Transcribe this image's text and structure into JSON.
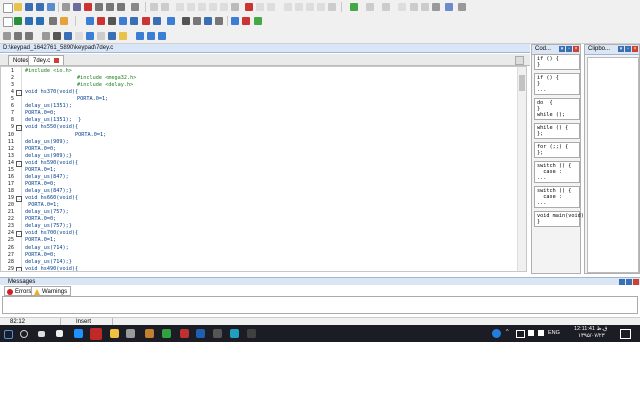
{
  "path_bar": "D:\\keypad_1642761_5890\\keypad\\7dey.c",
  "file_tabs": [
    "Notes",
    "7dey.c"
  ],
  "code_lines": [
    {
      "n": "1",
      "text": "#include <io.h>",
      "indent": 0,
      "pre": true,
      "fold": ""
    },
    {
      "n": "2",
      "text": "#include <mega32.h>",
      "indent": 52,
      "pre": true,
      "fold": ""
    },
    {
      "n": "3",
      "text": "#include <delay.h>",
      "indent": 52,
      "pre": true,
      "fold": ""
    },
    {
      "n": "4",
      "text": "void hs370(void){",
      "indent": 0,
      "pre": false,
      "fold": "-"
    },
    {
      "n": "5",
      "text": "PORTA.0=1;",
      "indent": 52,
      "pre": false,
      "fold": ""
    },
    {
      "n": "6",
      "text": "delay_us(1351);",
      "indent": 0,
      "pre": false,
      "fold": ""
    },
    {
      "n": "7",
      "text": "PORTA.0=0;",
      "indent": 0,
      "pre": false,
      "fold": ""
    },
    {
      "n": "8",
      "text": "delay_us(1351);  }",
      "indent": 0,
      "pre": false,
      "fold": ""
    },
    {
      "n": "9",
      "text": "void hs550(void){",
      "indent": 0,
      "pre": false,
      "fold": "-"
    },
    {
      "n": "10",
      "text": "PORTA.0=1;",
      "indent": 50,
      "pre": false,
      "fold": ""
    },
    {
      "n": "11",
      "text": "delay_us(909);",
      "indent": 0,
      "pre": false,
      "fold": ""
    },
    {
      "n": "12",
      "text": "PORTA.0=0;",
      "indent": 0,
      "pre": false,
      "fold": ""
    },
    {
      "n": "13",
      "text": "delay_us(909);}",
      "indent": 0,
      "pre": false,
      "fold": ""
    },
    {
      "n": "14",
      "text": "void hs590(void){",
      "indent": 0,
      "pre": false,
      "fold": "-"
    },
    {
      "n": "15",
      "text": "PORTA.0=1;",
      "indent": 0,
      "pre": false,
      "fold": ""
    },
    {
      "n": "16",
      "text": "delay_us(847);",
      "indent": 0,
      "pre": false,
      "fold": ""
    },
    {
      "n": "17",
      "text": "PORTA.0=0;",
      "indent": 0,
      "pre": false,
      "fold": ""
    },
    {
      "n": "18",
      "text": "delay_us(847);}",
      "indent": 0,
      "pre": false,
      "fold": ""
    },
    {
      "n": "19",
      "text": "void hs660(void){",
      "indent": 0,
      "pre": false,
      "fold": "-"
    },
    {
      "n": "20",
      "text": " PORTA.0=1;",
      "indent": 0,
      "pre": false,
      "fold": ""
    },
    {
      "n": "21",
      "text": "delay_us(757);",
      "indent": 0,
      "pre": false,
      "fold": ""
    },
    {
      "n": "22",
      "text": "PORTA.0=0;",
      "indent": 0,
      "pre": false,
      "fold": ""
    },
    {
      "n": "23",
      "text": "delay_us(757);}",
      "indent": 0,
      "pre": false,
      "fold": ""
    },
    {
      "n": "24",
      "text": "void hs700(void){",
      "indent": 0,
      "pre": false,
      "fold": "-"
    },
    {
      "n": "25",
      "text": "PORTA.0=1;",
      "indent": 0,
      "pre": false,
      "fold": ""
    },
    {
      "n": "26",
      "text": "delay_us(714);",
      "indent": 0,
      "pre": false,
      "fold": ""
    },
    {
      "n": "27",
      "text": "PORTA.0=0;",
      "indent": 0,
      "pre": false,
      "fold": ""
    },
    {
      "n": "28",
      "text": "delay_us(714);}",
      "indent": 0,
      "pre": false,
      "fold": ""
    },
    {
      "n": "29",
      "text": "void hs490(void){",
      "indent": 0,
      "pre": false,
      "fold": "-"
    }
  ],
  "code_panel_title": "Cod...",
  "clipboard_panel_title": "Clipbo...",
  "snippets": [
    {
      "text": "if () {\n}",
      "h": 2
    },
    {
      "text": "if () {\n}\n...",
      "h": 3
    },
    {
      "text": "do  {\n}\nwhile ();",
      "h": 3
    },
    {
      "text": "while () {\n};",
      "h": 2
    },
    {
      "text": "for (;;) {\n};",
      "h": 2
    },
    {
      "text": "switch () {\n  case :\n...",
      "h": 3
    },
    {
      "text": "switch () {\n  case :\n...",
      "h": 3
    },
    {
      "text": "void main(void)\n}",
      "h": 2
    }
  ],
  "messages_title": "Messages",
  "msg_tabs": [
    "Errors",
    "Warnings"
  ],
  "status": {
    "position": "82:12",
    "mode": "Insert"
  },
  "tray": {
    "lang": "ENG",
    "time": "12:11:41 ق.ظ",
    "date": "۱۳۹۵/۰۷/۲۳"
  },
  "colors": {
    "accent": "#dbe6f5",
    "taskbar": "#1c1c24",
    "code": "#003e8c",
    "preprocessor": "#1a7f1a"
  }
}
